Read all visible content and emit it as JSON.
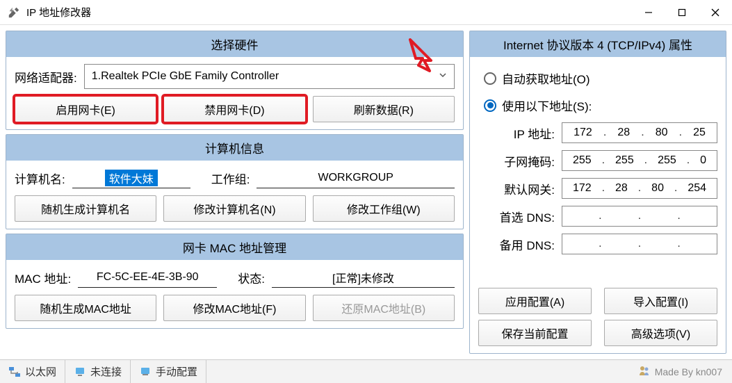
{
  "window": {
    "title": "IP 地址修改器"
  },
  "hardware": {
    "header": "选择硬件",
    "adapter_label": "网络适配器:",
    "adapter_selected": "1.Realtek PCIe GbE Family Controller",
    "enable_btn": "启用网卡(E)",
    "disable_btn": "禁用网卡(D)",
    "refresh_btn": "刷新数据(R)"
  },
  "computer": {
    "header": "计算机信息",
    "name_label": "计算机名:",
    "name_value": "软件大妹",
    "workgroup_label": "工作组:",
    "workgroup_value": "WORKGROUP",
    "random_name_btn": "随机生成计算机名",
    "modify_name_btn": "修改计算机名(N)",
    "modify_workgroup_btn": "修改工作组(W)"
  },
  "mac": {
    "header": "网卡 MAC 地址管理",
    "mac_label": "MAC 地址:",
    "mac_value": "FC-5C-EE-4E-3B-90",
    "status_label": "状态:",
    "status_value": "[正常]未修改",
    "random_mac_btn": "随机生成MAC地址",
    "modify_mac_btn": "修改MAC地址(F)",
    "restore_mac_btn": "还原MAC地址(B)"
  },
  "ipv4": {
    "header": "Internet 协议版本 4 (TCP/IPv4) 属性",
    "auto_label": "自动获取地址(O)",
    "manual_label": "使用以下地址(S):",
    "ip_label": "IP 地址:",
    "ip_parts": [
      "172",
      "28",
      "80",
      "25"
    ],
    "mask_label": "子网掩码:",
    "mask_parts": [
      "255",
      "255",
      "255",
      "0"
    ],
    "gateway_label": "默认网关:",
    "gateway_parts": [
      "172",
      "28",
      "80",
      "254"
    ],
    "dns1_label": "首选 DNS:",
    "dns1_parts": [
      "",
      "",
      "",
      ""
    ],
    "dns2_label": "备用 DNS:",
    "dns2_parts": [
      "",
      "",
      "",
      ""
    ],
    "apply_btn": "应用配置(A)",
    "import_btn": "导入配置(I)",
    "save_btn": "保存当前配置",
    "advanced_btn": "高级选项(V)"
  },
  "statusbar": {
    "nic": "以太网",
    "connection": "未连接",
    "config": "手动配置",
    "made_by": "Made By kn007"
  }
}
